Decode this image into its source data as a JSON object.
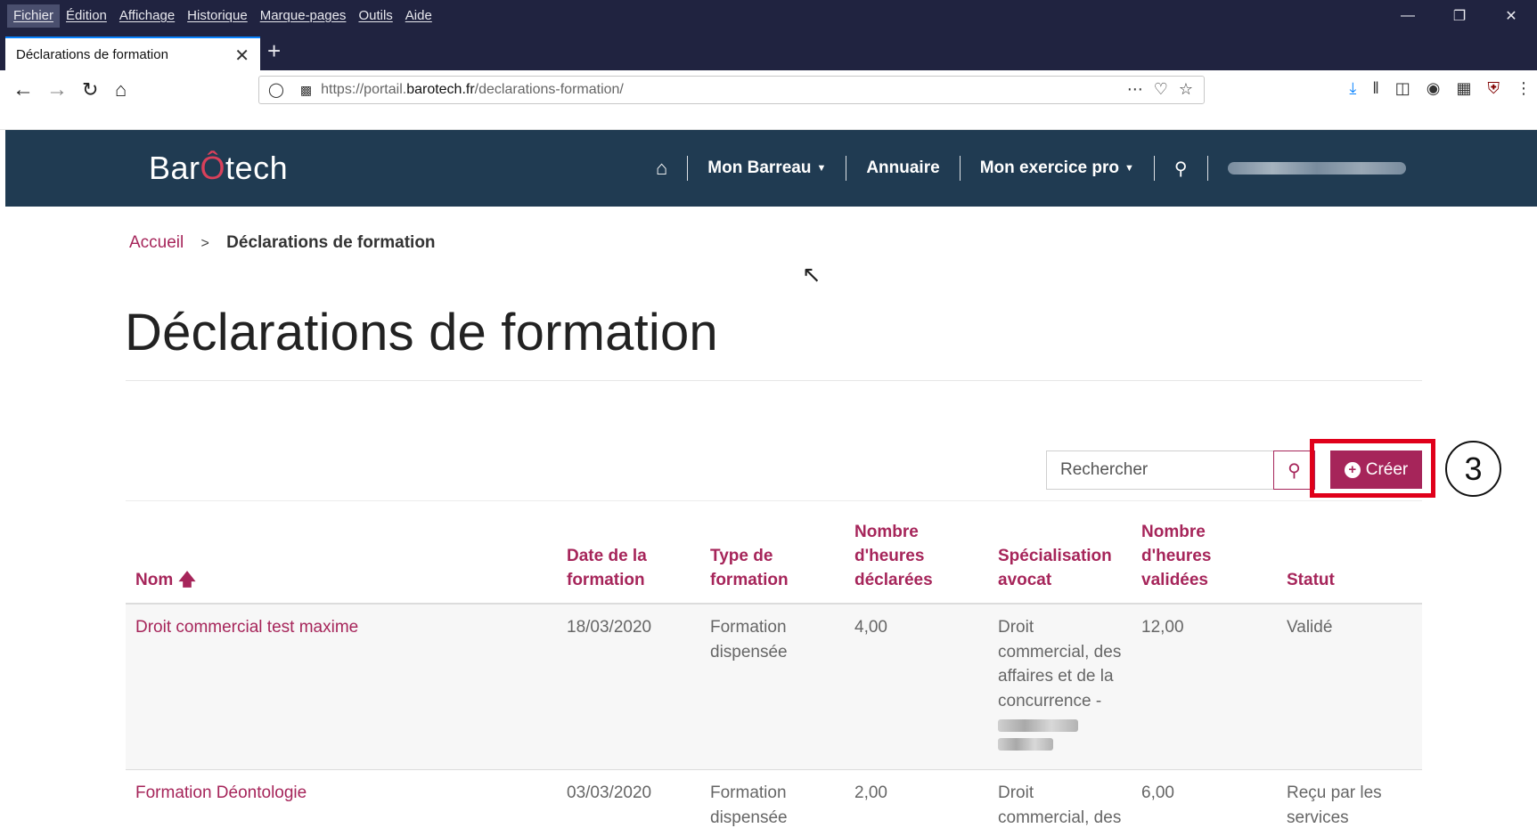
{
  "browser": {
    "menu": [
      "Fichier",
      "Édition",
      "Affichage",
      "Historique",
      "Marque-pages",
      "Outils",
      "Aide"
    ],
    "tab_title": "Déclarations de formation",
    "url_prefix": "https://portail.",
    "url_domain": "barotech.fr",
    "url_path": "/declarations-formation/"
  },
  "site": {
    "logo_part1": "Bar",
    "logo_accent": "Ô",
    "logo_part2": "tech",
    "nav": {
      "mon_barreau": "Mon Barreau",
      "annuaire": "Annuaire",
      "mon_exercice": "Mon exercice pro"
    }
  },
  "breadcrumb": {
    "home": "Accueil",
    "separator": ">",
    "current": "Déclarations de formation"
  },
  "page_title": "Déclarations de formation",
  "search": {
    "placeholder": "Rechercher"
  },
  "create_label": "Créer",
  "annotation_step": "3",
  "table": {
    "headers": {
      "nom": "Nom",
      "date": [
        "Date de la",
        "formation"
      ],
      "type": [
        "Type de",
        "formation"
      ],
      "declared": [
        "Nombre",
        "d'heures",
        "déclarées"
      ],
      "spec": [
        "Spécialisation",
        "avocat"
      ],
      "validated": [
        "Nombre",
        "d'heures",
        "validées"
      ],
      "status": "Statut"
    },
    "rows": [
      {
        "nom": "Droit commercial test maxime",
        "date": "18/03/2020",
        "type": [
          "Formation",
          "dispensée"
        ],
        "declared": "4,00",
        "spec": [
          "Droit",
          "commercial, des",
          "affaires et de la",
          "concurrence -"
        ],
        "validated": "12,00",
        "status": "Validé"
      },
      {
        "nom": "Formation Déontologie",
        "date": "03/03/2020",
        "type": [
          "Formation",
          "dispensée"
        ],
        "declared": "2,00",
        "spec": [
          "Droit",
          "commercial, des"
        ],
        "validated": "6,00",
        "status": "Reçu par les services"
      }
    ]
  },
  "colors": {
    "accent": "#a6255a",
    "header_bg": "#203b52",
    "chrome_bg": "#202340",
    "highlight": "#e0001a"
  }
}
